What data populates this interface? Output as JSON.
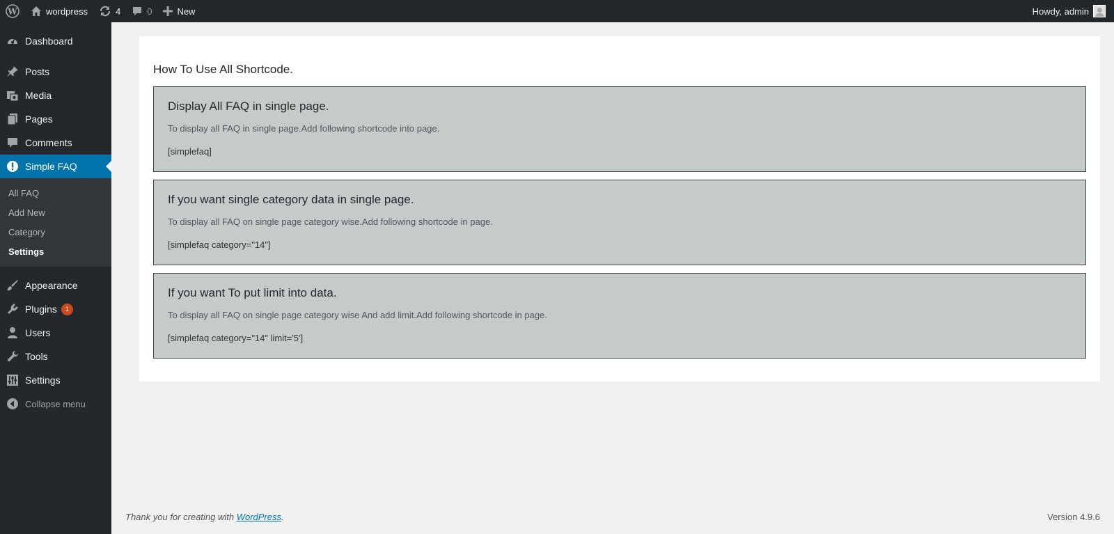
{
  "adminbar": {
    "site_name": "wordpress",
    "updates_count": "4",
    "comments_count": "0",
    "new_label": "New",
    "howdy": "Howdy, admin"
  },
  "sidebar": {
    "items": [
      {
        "label": "Dashboard",
        "icon": "dashboard-icon"
      },
      {
        "label": "Posts",
        "icon": "pin-icon"
      },
      {
        "label": "Media",
        "icon": "media-icon"
      },
      {
        "label": "Pages",
        "icon": "pages-icon"
      },
      {
        "label": "Comments",
        "icon": "comment-icon"
      },
      {
        "label": "Simple FAQ",
        "icon": "alert-icon"
      },
      {
        "label": "Appearance",
        "icon": "brush-icon"
      },
      {
        "label": "Plugins",
        "icon": "plug-icon",
        "badge": "1"
      },
      {
        "label": "Users",
        "icon": "user-icon"
      },
      {
        "label": "Tools",
        "icon": "wrench-icon"
      },
      {
        "label": "Settings",
        "icon": "sliders-icon"
      }
    ],
    "submenu": [
      "All FAQ",
      "Add New",
      "Category",
      "Settings"
    ],
    "collapse_label": "Collapse menu"
  },
  "main": {
    "heading": "How To Use All Shortcode.",
    "cards": [
      {
        "title": "Display All FAQ in single page.",
        "desc": "To display all FAQ in single page.Add following shortcode into page.",
        "code": "[simplefaq]"
      },
      {
        "title": "If you want single category data in single page.",
        "desc": "To display all FAQ on single page category wise.Add following shortcode in page.",
        "code": "[simplefaq category=\"14\"]"
      },
      {
        "title": "If you want To put limit into data.",
        "desc": "To display all FAQ on single page category wise And add limit.Add following shortcode in page.",
        "code": "[simplefaq category=\"14\" limit='5']"
      }
    ]
  },
  "footer": {
    "thanks_prefix": "Thank you for creating with ",
    "thanks_link": "WordPress",
    "thanks_suffix": ".",
    "version": "Version 4.9.6"
  },
  "colors": {
    "adminbar_bg": "#23282d",
    "active_menu": "#0073aa",
    "card_bg": "#c5cbc9",
    "badge": "#ca4a1f"
  }
}
